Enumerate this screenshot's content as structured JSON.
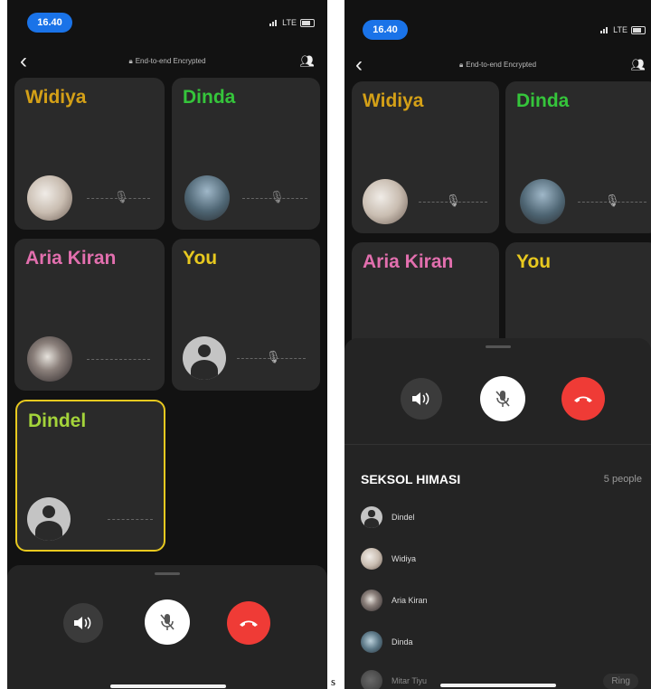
{
  "status_bar": {
    "time": "16.40",
    "network": "LTE"
  },
  "header": {
    "encryption": "End-to-end Encrypted"
  },
  "participants": [
    {
      "name": "Widiya",
      "color": "#d4a017"
    },
    {
      "name": "Dinda",
      "color": "#35c53b"
    },
    {
      "name": "Aria Kiran",
      "color": "#e26fae"
    },
    {
      "name": "You",
      "color": "#e8c91f"
    },
    {
      "name": "Dindel",
      "color": "#a4d43a"
    }
  ],
  "colors": {
    "active_border": "#e8c91f",
    "end_call": "#ef3b36",
    "status_time_bg": "#1a73e8"
  },
  "group": {
    "title": "SEKSOL HIMASI",
    "count": "5 people"
  },
  "people_list": [
    {
      "name": "Dindel"
    },
    {
      "name": "Widiya"
    },
    {
      "name": "Aria Kiran"
    },
    {
      "name": "Dinda"
    },
    {
      "name": "Mitar Tiyu"
    }
  ],
  "ring_label": "Ring",
  "stray_char": "s"
}
